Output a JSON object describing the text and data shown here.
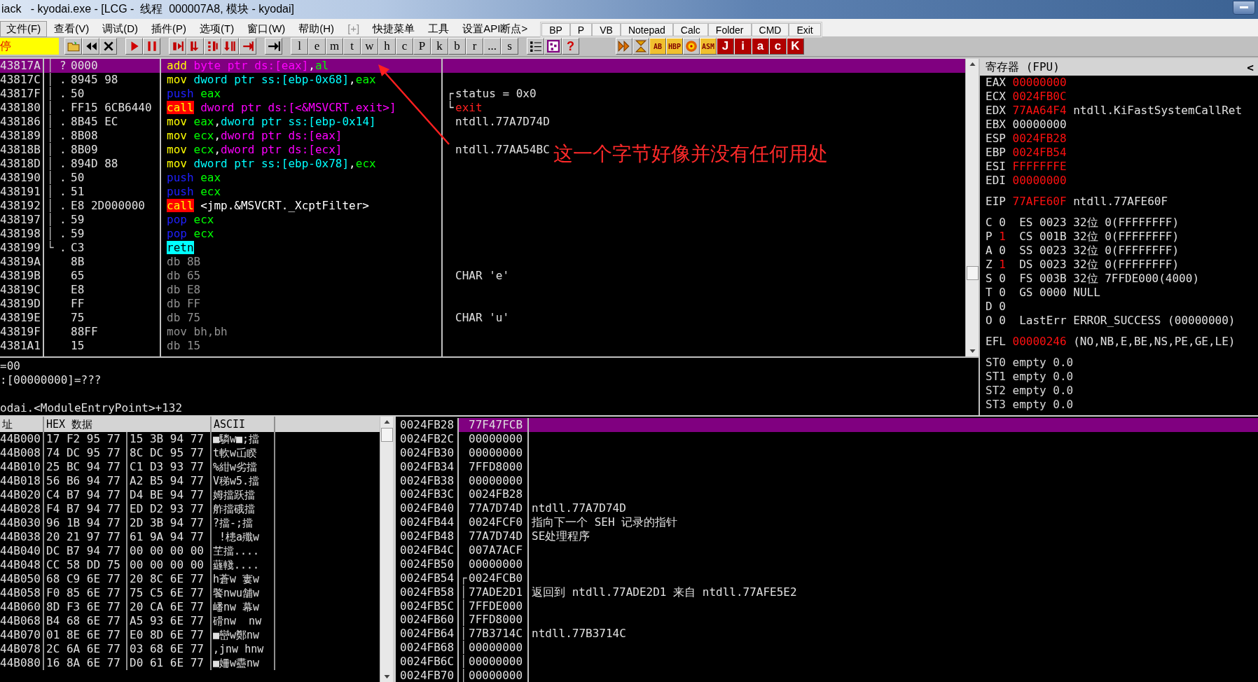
{
  "window": {
    "title": "iack   - kyodai.exe - [LCG -  线程  000007A8, 模块 - kyodai]"
  },
  "menu": [
    {
      "label": "文件(F)",
      "selected": true,
      "disabled": false
    },
    {
      "label": "查看(V)",
      "selected": false,
      "disabled": false
    },
    {
      "label": "调试(D)",
      "selected": false,
      "disabled": false
    },
    {
      "label": "插件(P)",
      "selected": false,
      "disabled": false
    },
    {
      "label": "选项(T)",
      "selected": false,
      "disabled": false
    },
    {
      "label": "窗口(W)",
      "selected": false,
      "disabled": false
    },
    {
      "label": "帮助(H)",
      "selected": false,
      "disabled": false
    },
    {
      "label": "[+]",
      "selected": false,
      "disabled": true
    },
    {
      "label": "快捷菜单",
      "selected": false,
      "disabled": false
    },
    {
      "label": "工具",
      "selected": false,
      "disabled": false
    },
    {
      "label": "设置API断点>",
      "selected": false,
      "disabled": false
    }
  ],
  "quick_buttons": [
    "BP",
    "P",
    "VB",
    "Notepad",
    "Calc",
    "Folder",
    "CMD",
    "Exit"
  ],
  "toolbar": {
    "status": "停",
    "letters": [
      "l",
      "e",
      "m",
      "t",
      "w",
      "h",
      "c",
      "P",
      "k",
      "b",
      "r",
      "...",
      "s"
    ],
    "help": "?",
    "plugin_labels": [
      "AB",
      "HBP",
      "ASM"
    ],
    "logo_letters": [
      "J",
      "i",
      "a",
      "c",
      "K"
    ]
  },
  "disassembly": {
    "rows": [
      {
        "address": "43817A",
        "bracket": "│",
        "marker": "?",
        "hex": "0000",
        "mnemonic": {
          "text": "add",
          "kind": "move"
        },
        "operands": [
          {
            "text": "byte ptr ds:[eax]",
            "kind": "ds"
          },
          {
            "text": ",",
            "kind": "plain"
          },
          {
            "text": "al",
            "kind": "reg"
          }
        ],
        "selected": true
      },
      {
        "address": "43817C",
        "bracket": "│",
        "marker": ".",
        "hex": "8945 98",
        "mnemonic": {
          "text": "mov",
          "kind": "move"
        },
        "operands": [
          {
            "text": "dword ptr ss:[ebp-0x68]",
            "kind": "ss"
          },
          {
            "text": ",",
            "kind": "plain"
          },
          {
            "text": "eax",
            "kind": "reg"
          }
        ],
        "selected": false
      },
      {
        "address": "43817F",
        "bracket": "│",
        "marker": ".",
        "hex": "50",
        "mnemonic": {
          "text": "push",
          "kind": "stack"
        },
        "operands": [
          {
            "text": "eax",
            "kind": "reg"
          }
        ],
        "selected": false,
        "comment": {
          "bracket": "┌",
          "text": "status = 0x0",
          "kind": "plain"
        }
      },
      {
        "address": "438180",
        "bracket": "│",
        "marker": ".",
        "hex": "FF15 6CB6440",
        "mnemonic": {
          "text": "call",
          "kind": "call"
        },
        "operands": [
          {
            "text": "dword ptr ds:[<&MSVCRT.exit>]",
            "kind": "ds"
          }
        ],
        "selected": false,
        "comment": {
          "bracket": "└",
          "text": "exit",
          "kind": "api"
        }
      },
      {
        "address": "438186",
        "bracket": "│",
        "marker": ".",
        "hex": "8B45 EC",
        "mnemonic": {
          "text": "mov",
          "kind": "move"
        },
        "operands": [
          {
            "text": "eax",
            "kind": "reg"
          },
          {
            "text": ",",
            "kind": "plain"
          },
          {
            "text": "dword ptr ss:[ebp-0x14]",
            "kind": "ss"
          }
        ],
        "selected": false,
        "comment": {
          "text": "ntdll.77A7D74D",
          "kind": "plain"
        }
      },
      {
        "address": "438189",
        "bracket": "│",
        "marker": ".",
        "hex": "8B08",
        "mnemonic": {
          "text": "mov",
          "kind": "move"
        },
        "operands": [
          {
            "text": "ecx",
            "kind": "reg"
          },
          {
            "text": ",",
            "kind": "plain"
          },
          {
            "text": "dword ptr ds:[eax]",
            "kind": "ds"
          }
        ],
        "selected": false
      },
      {
        "address": "43818B",
        "bracket": "│",
        "marker": ".",
        "hex": "8B09",
        "mnemonic": {
          "text": "mov",
          "kind": "move"
        },
        "operands": [
          {
            "text": "ecx",
            "kind": "reg"
          },
          {
            "text": ",",
            "kind": "plain"
          },
          {
            "text": "dword ptr ds:[ecx]",
            "kind": "ds"
          }
        ],
        "selected": false,
        "comment": {
          "text": "ntdll.77AA54BC",
          "kind": "plain"
        }
      },
      {
        "address": "43818D",
        "bracket": "│",
        "marker": ".",
        "hex": "894D 88",
        "mnemonic": {
          "text": "mov",
          "kind": "move"
        },
        "operands": [
          {
            "text": "dword ptr ss:[ebp-0x78]",
            "kind": "ss"
          },
          {
            "text": ",",
            "kind": "plain"
          },
          {
            "text": "ecx",
            "kind": "reg"
          }
        ],
        "selected": false
      },
      {
        "address": "438190",
        "bracket": "│",
        "marker": ".",
        "hex": "50",
        "mnemonic": {
          "text": "push",
          "kind": "stack"
        },
        "operands": [
          {
            "text": "eax",
            "kind": "reg"
          }
        ],
        "selected": false
      },
      {
        "address": "438191",
        "bracket": "│",
        "marker": ".",
        "hex": "51",
        "mnemonic": {
          "text": "push",
          "kind": "stack"
        },
        "operands": [
          {
            "text": "ecx",
            "kind": "reg"
          }
        ],
        "selected": false
      },
      {
        "address": "438192",
        "bracket": "│",
        "marker": ".",
        "hex": "E8 2D000000",
        "mnemonic": {
          "text": "call",
          "kind": "call"
        },
        "operands": [
          {
            "text": "<jmp.&MSVCRT._XcptFilter>",
            "kind": "plain"
          }
        ],
        "selected": false
      },
      {
        "address": "438197",
        "bracket": "│",
        "marker": ".",
        "hex": "59",
        "mnemonic": {
          "text": "pop",
          "kind": "stack"
        },
        "operands": [
          {
            "text": "ecx",
            "kind": "reg"
          }
        ],
        "selected": false
      },
      {
        "address": "438198",
        "bracket": "│",
        "marker": ".",
        "hex": "59",
        "mnemonic": {
          "text": "pop",
          "kind": "stack"
        },
        "operands": [
          {
            "text": "ecx",
            "kind": "reg"
          }
        ],
        "selected": false
      },
      {
        "address": "438199",
        "bracket": "└",
        "marker": ".",
        "hex": "C3",
        "mnemonic": {
          "text": "retn",
          "kind": "ret"
        },
        "operands": [],
        "selected": false
      },
      {
        "address": "43819A",
        "hex": "8B",
        "mnemonic": {
          "text": "db",
          "kind": "data"
        },
        "operands": [
          {
            "text": "8B",
            "kind": "data"
          }
        ],
        "selected": false
      },
      {
        "address": "43819B",
        "hex": "65",
        "mnemonic": {
          "text": "db",
          "kind": "data"
        },
        "operands": [
          {
            "text": "65",
            "kind": "data"
          }
        ],
        "selected": false,
        "comment": {
          "text": "CHAR 'e'",
          "kind": "plain"
        }
      },
      {
        "address": "43819C",
        "hex": "E8",
        "mnemonic": {
          "text": "db",
          "kind": "data"
        },
        "operands": [
          {
            "text": "E8",
            "kind": "data"
          }
        ],
        "selected": false
      },
      {
        "address": "43819D",
        "hex": "FF",
        "mnemonic": {
          "text": "db",
          "kind": "data"
        },
        "operands": [
          {
            "text": "FF",
            "kind": "data"
          }
        ],
        "selected": false
      },
      {
        "address": "43819E",
        "hex": "75",
        "mnemonic": {
          "text": "db",
          "kind": "data"
        },
        "operands": [
          {
            "text": "75",
            "kind": "data"
          }
        ],
        "selected": false,
        "comment": {
          "text": "CHAR 'u'",
          "kind": "plain"
        }
      },
      {
        "address": "43819F",
        "hex": "88FF",
        "mnemonic": {
          "text": "mov",
          "kind": "data"
        },
        "operands": [
          {
            "text": "bh,bh",
            "kind": "data"
          }
        ],
        "selected": false
      },
      {
        "address": "4381A1",
        "hex": "15",
        "mnemonic": {
          "text": "db",
          "kind": "data"
        },
        "operands": [
          {
            "text": "15",
            "kind": "data"
          }
        ],
        "selected": false
      }
    ]
  },
  "annotation": {
    "text": "这一个字节好像并没有任何用处"
  },
  "info": {
    "lines": [
      "=00",
      ":[00000000]=???"
    ],
    "location": "odai.<ModuleEntryPoint>+132"
  },
  "registers": {
    "title": "寄存器 (FPU)",
    "collapse": "<",
    "groups": [
      [
        {
          "kind": "reg",
          "name": "EAX",
          "value": "00000000",
          "changed": true
        },
        {
          "kind": "reg",
          "name": "ECX",
          "value": "0024FB0C",
          "changed": true
        },
        {
          "kind": "reg",
          "name": "EDX",
          "value": "77AA64F4",
          "changed": true,
          "comment": "ntdll.KiFastSystemCallRet"
        },
        {
          "kind": "reg",
          "name": "EBX",
          "value": "00000000",
          "changed": false
        },
        {
          "kind": "reg",
          "name": "ESP",
          "value": "0024FB28",
          "changed": true
        },
        {
          "kind": "reg",
          "name": "EBP",
          "value": "0024FB54",
          "changed": true
        },
        {
          "kind": "reg",
          "name": "ESI",
          "value": "FFFFFFFE",
          "changed": true
        },
        {
          "kind": "reg",
          "name": "EDI",
          "value": "00000000",
          "changed": true
        }
      ],
      [
        {
          "kind": "reg",
          "name": "EIP",
          "value": "77AFE60F",
          "changed": true,
          "comment": "ntdll.77AFE60F"
        }
      ],
      [
        {
          "kind": "flag",
          "name": "C",
          "value": "0",
          "changed": false,
          "comment": "ES 0023 32位 0(FFFFFFFF)"
        },
        {
          "kind": "flag",
          "name": "P",
          "value": "1",
          "changed": true,
          "comment": "CS 001B 32位 0(FFFFFFFF)"
        },
        {
          "kind": "flag",
          "name": "A",
          "value": "0",
          "changed": false,
          "comment": "SS 0023 32位 0(FFFFFFFF)"
        },
        {
          "kind": "flag",
          "name": "Z",
          "value": "1",
          "changed": true,
          "comment": "DS 0023 32位 0(FFFFFFFF)"
        },
        {
          "kind": "flag",
          "name": "S",
          "value": "0",
          "changed": false,
          "comment": "FS 003B 32位 7FFDE000(4000)"
        },
        {
          "kind": "flag",
          "name": "T",
          "value": "0",
          "changed": false,
          "comment": "GS 0000 NULL"
        },
        {
          "kind": "flag",
          "name": "D",
          "value": "0",
          "changed": false
        },
        {
          "kind": "flag",
          "name": "O",
          "value": "0",
          "changed": false,
          "comment": "LastErr ERROR_SUCCESS (00000000)"
        }
      ],
      [
        {
          "kind": "reg",
          "name": "EFL",
          "value": "00000246",
          "changed": true,
          "comment": "(NO,NB,E,BE,NS,PE,GE,LE)"
        }
      ],
      [
        {
          "kind": "fpu",
          "name": "ST0",
          "value": "empty 0.0",
          "changed": false
        },
        {
          "kind": "fpu",
          "name": "ST1",
          "value": "empty 0.0",
          "changed": false
        },
        {
          "kind": "fpu",
          "name": "ST2",
          "value": "empty 0.0",
          "changed": false
        },
        {
          "kind": "fpu",
          "name": "ST3",
          "value": "empty 0.0",
          "changed": false
        }
      ]
    ]
  },
  "dump": {
    "columns": [
      "址",
      "HEX 数据",
      "ASCII"
    ],
    "rows": [
      {
        "address": "44B000",
        "hex1": "17 F2 95 77",
        "hex2": "15 3B 94 77",
        "ascii": "■驎w■;擋"
      },
      {
        "address": "44B008",
        "hex1": "74 DC 95 77",
        "hex2": "8C DC 95 77",
        "ascii": "t軟w屲睽"
      },
      {
        "address": "44B010",
        "hex1": "25 BC 94 77",
        "hex2": "C1 D3 93 77",
        "ascii": "%紺w劣擋"
      },
      {
        "address": "44B018",
        "hex1": "56 B6 94 77",
        "hex2": "A2 B5 94 77",
        "ascii": "V稊w5.擋"
      },
      {
        "address": "44B020",
        "hex1": "C4 B7 94 77",
        "hex2": "D4 BE 94 77",
        "ascii": "姆擋跃擋"
      },
      {
        "address": "44B028",
        "hex1": "F4 B7 94 77",
        "hex2": "ED D2 93 77",
        "ascii": "舴擋硪擋"
      },
      {
        "address": "44B030",
        "hex1": "96 1B 94 77",
        "hex2": "2D 3B 94 77",
        "ascii": "?擋-;擋"
      },
      {
        "address": "44B038",
        "hex1": "20 21 97 77",
        "hex2": "61 9A 94 77",
        "ascii": " !槵a殲w"
      },
      {
        "address": "44B040",
        "hex1": "DC B7 94 77",
        "hex2": "00 00 00 00",
        "ascii": "芏擋...."
      },
      {
        "address": "44B048",
        "hex1": "CC 58 DD 75",
        "hex2": "00 00 00 00",
        "ascii": "蘕輚...."
      },
      {
        "address": "44B050",
        "hex1": "68 C9 6E 77",
        "hex2": "20 8C 6E 77",
        "ascii": "h蒼w 寠w"
      },
      {
        "address": "44B058",
        "hex1": "F0 85 6E 77",
        "hex2": "75 C5 6E 77",
        "ascii": "饏nwu舗w"
      },
      {
        "address": "44B060",
        "hex1": "8D F3 6E 77",
        "hex2": "20 CA 6E 77",
        "ascii": "嶓nw 幕w"
      },
      {
        "address": "44B068",
        "hex1": "B4 68 6E 77",
        "hex2": "A5 93 6E 77",
        "ascii": "磆nw  nw"
      },
      {
        "address": "44B070",
        "hex1": "01 8E 6E 77",
        "hex2": "E0 8D 6E 77",
        "ascii": "■巒w鄭nw"
      },
      {
        "address": "44B078",
        "hex1": "2C 6A 6E 77",
        "hex2": "03 68 6E 77",
        "ascii": ",jnw hnw"
      },
      {
        "address": "44B080",
        "hex1": "16 8A 6E 77",
        "hex2": "D0 61 6E 77",
        "ascii": "■姍w衋nw"
      }
    ]
  },
  "stack": {
    "rows": [
      {
        "address": "0024FB28",
        "value": "77F47FCB",
        "selected": true
      },
      {
        "address": "0024FB2C",
        "value": "00000000",
        "selected": false
      },
      {
        "address": "0024FB30",
        "value": "00000000",
        "selected": false
      },
      {
        "address": "0024FB34",
        "value": "7FFD8000",
        "selected": false
      },
      {
        "address": "0024FB38",
        "value": "00000000",
        "selected": false
      },
      {
        "address": "0024FB3C",
        "value": "0024FB28",
        "selected": false
      },
      {
        "address": "0024FB40",
        "value": "77A7D74D",
        "selected": false,
        "comment": "ntdll.77A7D74D"
      },
      {
        "address": "0024FB44",
        "value": "0024FCF0",
        "selected": false,
        "comment": "指向下一个 SEH 记录的指针"
      },
      {
        "address": "0024FB48",
        "value": "77A7D74D",
        "selected": false,
        "comment": "SE处理程序"
      },
      {
        "address": "0024FB4C",
        "value": "007A7ACF",
        "selected": false
      },
      {
        "address": "0024FB50",
        "value": "00000000",
        "selected": false
      },
      {
        "address": "0024FB54",
        "bracket": "┌",
        "value": "0024FCB0",
        "selected": false
      },
      {
        "address": "0024FB58",
        "bracket": "│",
        "value": "77ADE2D1",
        "selected": false,
        "comment": "返回到 ntdll.77ADE2D1 来自 ntdll.77AFE5E2"
      },
      {
        "address": "0024FB5C",
        "bracket": "│",
        "value": "7FFDE000",
        "selected": false
      },
      {
        "address": "0024FB60",
        "bracket": "│",
        "value": "7FFD8000",
        "selected": false
      },
      {
        "address": "0024FB64",
        "bracket": "│",
        "value": "77B3714C",
        "selected": false,
        "comment": "ntdll.77B3714C"
      },
      {
        "address": "0024FB68",
        "bracket": "│",
        "value": "00000000",
        "selected": false
      },
      {
        "address": "0024FB6C",
        "bracket": "│",
        "value": "00000000",
        "selected": false
      },
      {
        "address": "0024FB70",
        "bracket": "│",
        "value": "00000000",
        "selected": false
      }
    ]
  }
}
